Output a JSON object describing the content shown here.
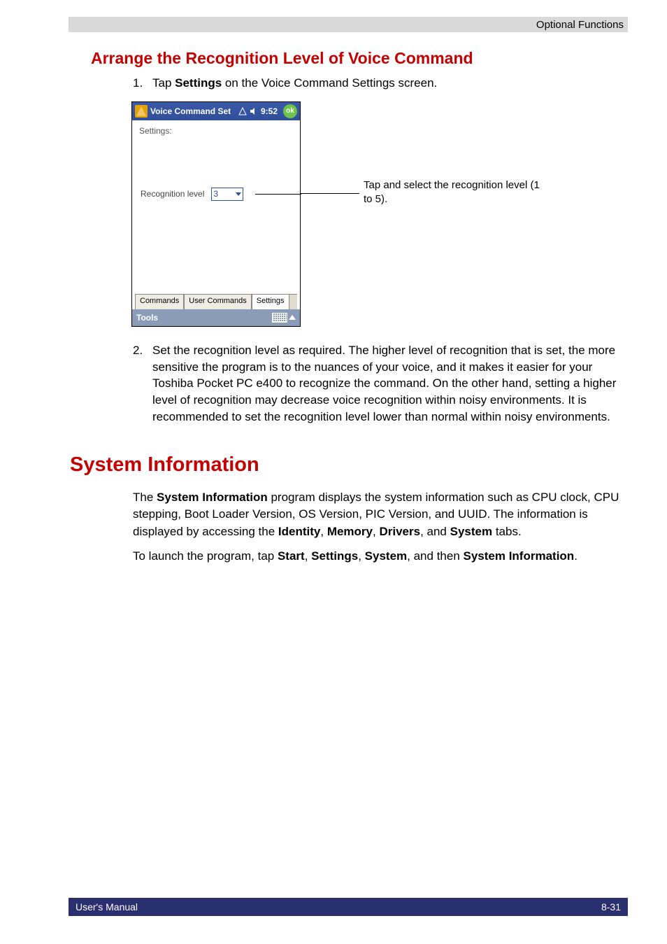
{
  "header": {
    "section_label": "Optional Functions"
  },
  "h2": "Arrange the Recognition Level of Voice Command",
  "step1": {
    "num": "1.",
    "prefix": "Tap ",
    "bold": "Settings",
    "suffix": " on the Voice Command Settings screen."
  },
  "device": {
    "title": "Voice Command Set",
    "time": "9:52",
    "ok": "ok",
    "settings_label": "Settings:",
    "reco_label": "Recognition level",
    "reco_value": "3",
    "tabs": {
      "commands": "Commands",
      "user_commands": "User Commands",
      "settings": "Settings"
    },
    "toolbar": "Tools"
  },
  "callout": "Tap and select the recognition level (1 to 5).",
  "step2": {
    "num": "2.",
    "text": "Set the recognition level as required. The higher level of recognition that is set, the more sensitive the program is to the nuances of your voice, and it makes it easier for your Toshiba Pocket PC e400 to recognize the command. On the other hand, setting a higher level of recognition may decrease voice recognition within noisy environments. It is recommended to set the recognition level lower than normal within noisy environments."
  },
  "h1": "System Information",
  "para1": {
    "p1": "The ",
    "b1": "System Information",
    "p2": " program displays the system information such as CPU clock, CPU stepping, Boot Loader Version, OS Version, PIC Version, and UUID. The information is displayed by accessing the ",
    "b2": "Identity",
    "p3": ", ",
    "b3": "Memory",
    "p4": ", ",
    "b4": "Drivers",
    "p5": ", and ",
    "b5": "System",
    "p6": " tabs."
  },
  "para2": {
    "p1": "To launch the program, tap ",
    "b1": "Start",
    "p2": ", ",
    "b2": "Settings",
    "p3": ", ",
    "b3": "System",
    "p4": ", and then ",
    "b4": "System Information",
    "p5": "."
  },
  "footer": {
    "left": "User's Manual",
    "right": "8-31"
  }
}
